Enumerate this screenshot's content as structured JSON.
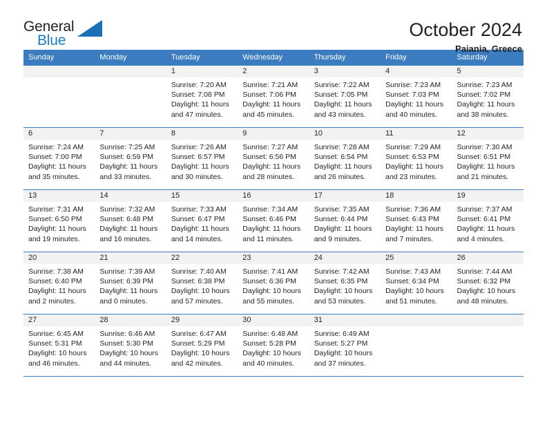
{
  "brand": {
    "name_top": "General",
    "name_bottom": "Blue",
    "accent_color": "#1a7bc4"
  },
  "header": {
    "title": "October 2024",
    "subtitle": "Paiania, Greece"
  },
  "theme": {
    "header_blue": "#3b7dc0",
    "daynum_bg": "#f2f2f2",
    "text": "#231f20"
  },
  "weekdays": [
    "Sunday",
    "Monday",
    "Tuesday",
    "Wednesday",
    "Thursday",
    "Friday",
    "Saturday"
  ],
  "labels": {
    "sunrise": "Sunrise:",
    "sunset": "Sunset:",
    "daylight": "Daylight:"
  },
  "weeks": [
    [
      {
        "day": ""
      },
      {
        "day": ""
      },
      {
        "day": "1",
        "sunrise": "Sunrise: 7:20 AM",
        "sunset": "Sunset: 7:08 PM",
        "daylight1": "Daylight: 11 hours",
        "daylight2": "and 47 minutes."
      },
      {
        "day": "2",
        "sunrise": "Sunrise: 7:21 AM",
        "sunset": "Sunset: 7:06 PM",
        "daylight1": "Daylight: 11 hours",
        "daylight2": "and 45 minutes."
      },
      {
        "day": "3",
        "sunrise": "Sunrise: 7:22 AM",
        "sunset": "Sunset: 7:05 PM",
        "daylight1": "Daylight: 11 hours",
        "daylight2": "and 43 minutes."
      },
      {
        "day": "4",
        "sunrise": "Sunrise: 7:23 AM",
        "sunset": "Sunset: 7:03 PM",
        "daylight1": "Daylight: 11 hours",
        "daylight2": "and 40 minutes."
      },
      {
        "day": "5",
        "sunrise": "Sunrise: 7:23 AM",
        "sunset": "Sunset: 7:02 PM",
        "daylight1": "Daylight: 11 hours",
        "daylight2": "and 38 minutes."
      }
    ],
    [
      {
        "day": "6",
        "sunrise": "Sunrise: 7:24 AM",
        "sunset": "Sunset: 7:00 PM",
        "daylight1": "Daylight: 11 hours",
        "daylight2": "and 35 minutes."
      },
      {
        "day": "7",
        "sunrise": "Sunrise: 7:25 AM",
        "sunset": "Sunset: 6:59 PM",
        "daylight1": "Daylight: 11 hours",
        "daylight2": "and 33 minutes."
      },
      {
        "day": "8",
        "sunrise": "Sunrise: 7:26 AM",
        "sunset": "Sunset: 6:57 PM",
        "daylight1": "Daylight: 11 hours",
        "daylight2": "and 30 minutes."
      },
      {
        "day": "9",
        "sunrise": "Sunrise: 7:27 AM",
        "sunset": "Sunset: 6:56 PM",
        "daylight1": "Daylight: 11 hours",
        "daylight2": "and 28 minutes."
      },
      {
        "day": "10",
        "sunrise": "Sunrise: 7:28 AM",
        "sunset": "Sunset: 6:54 PM",
        "daylight1": "Daylight: 11 hours",
        "daylight2": "and 26 minutes."
      },
      {
        "day": "11",
        "sunrise": "Sunrise: 7:29 AM",
        "sunset": "Sunset: 6:53 PM",
        "daylight1": "Daylight: 11 hours",
        "daylight2": "and 23 minutes."
      },
      {
        "day": "12",
        "sunrise": "Sunrise: 7:30 AM",
        "sunset": "Sunset: 6:51 PM",
        "daylight1": "Daylight: 11 hours",
        "daylight2": "and 21 minutes."
      }
    ],
    [
      {
        "day": "13",
        "sunrise": "Sunrise: 7:31 AM",
        "sunset": "Sunset: 6:50 PM",
        "daylight1": "Daylight: 11 hours",
        "daylight2": "and 19 minutes."
      },
      {
        "day": "14",
        "sunrise": "Sunrise: 7:32 AM",
        "sunset": "Sunset: 6:48 PM",
        "daylight1": "Daylight: 11 hours",
        "daylight2": "and 16 minutes."
      },
      {
        "day": "15",
        "sunrise": "Sunrise: 7:33 AM",
        "sunset": "Sunset: 6:47 PM",
        "daylight1": "Daylight: 11 hours",
        "daylight2": "and 14 minutes."
      },
      {
        "day": "16",
        "sunrise": "Sunrise: 7:34 AM",
        "sunset": "Sunset: 6:46 PM",
        "daylight1": "Daylight: 11 hours",
        "daylight2": "and 11 minutes."
      },
      {
        "day": "17",
        "sunrise": "Sunrise: 7:35 AM",
        "sunset": "Sunset: 6:44 PM",
        "daylight1": "Daylight: 11 hours",
        "daylight2": "and 9 minutes."
      },
      {
        "day": "18",
        "sunrise": "Sunrise: 7:36 AM",
        "sunset": "Sunset: 6:43 PM",
        "daylight1": "Daylight: 11 hours",
        "daylight2": "and 7 minutes."
      },
      {
        "day": "19",
        "sunrise": "Sunrise: 7:37 AM",
        "sunset": "Sunset: 6:41 PM",
        "daylight1": "Daylight: 11 hours",
        "daylight2": "and 4 minutes."
      }
    ],
    [
      {
        "day": "20",
        "sunrise": "Sunrise: 7:38 AM",
        "sunset": "Sunset: 6:40 PM",
        "daylight1": "Daylight: 11 hours",
        "daylight2": "and 2 minutes."
      },
      {
        "day": "21",
        "sunrise": "Sunrise: 7:39 AM",
        "sunset": "Sunset: 6:39 PM",
        "daylight1": "Daylight: 11 hours",
        "daylight2": "and 0 minutes."
      },
      {
        "day": "22",
        "sunrise": "Sunrise: 7:40 AM",
        "sunset": "Sunset: 6:38 PM",
        "daylight1": "Daylight: 10 hours",
        "daylight2": "and 57 minutes."
      },
      {
        "day": "23",
        "sunrise": "Sunrise: 7:41 AM",
        "sunset": "Sunset: 6:36 PM",
        "daylight1": "Daylight: 10 hours",
        "daylight2": "and 55 minutes."
      },
      {
        "day": "24",
        "sunrise": "Sunrise: 7:42 AM",
        "sunset": "Sunset: 6:35 PM",
        "daylight1": "Daylight: 10 hours",
        "daylight2": "and 53 minutes."
      },
      {
        "day": "25",
        "sunrise": "Sunrise: 7:43 AM",
        "sunset": "Sunset: 6:34 PM",
        "daylight1": "Daylight: 10 hours",
        "daylight2": "and 51 minutes."
      },
      {
        "day": "26",
        "sunrise": "Sunrise: 7:44 AM",
        "sunset": "Sunset: 6:32 PM",
        "daylight1": "Daylight: 10 hours",
        "daylight2": "and 48 minutes."
      }
    ],
    [
      {
        "day": "27",
        "sunrise": "Sunrise: 6:45 AM",
        "sunset": "Sunset: 5:31 PM",
        "daylight1": "Daylight: 10 hours",
        "daylight2": "and 46 minutes."
      },
      {
        "day": "28",
        "sunrise": "Sunrise: 6:46 AM",
        "sunset": "Sunset: 5:30 PM",
        "daylight1": "Daylight: 10 hours",
        "daylight2": "and 44 minutes."
      },
      {
        "day": "29",
        "sunrise": "Sunrise: 6:47 AM",
        "sunset": "Sunset: 5:29 PM",
        "daylight1": "Daylight: 10 hours",
        "daylight2": "and 42 minutes."
      },
      {
        "day": "30",
        "sunrise": "Sunrise: 6:48 AM",
        "sunset": "Sunset: 5:28 PM",
        "daylight1": "Daylight: 10 hours",
        "daylight2": "and 40 minutes."
      },
      {
        "day": "31",
        "sunrise": "Sunrise: 6:49 AM",
        "sunset": "Sunset: 5:27 PM",
        "daylight1": "Daylight: 10 hours",
        "daylight2": "and 37 minutes."
      },
      {
        "day": ""
      },
      {
        "day": ""
      }
    ]
  ]
}
